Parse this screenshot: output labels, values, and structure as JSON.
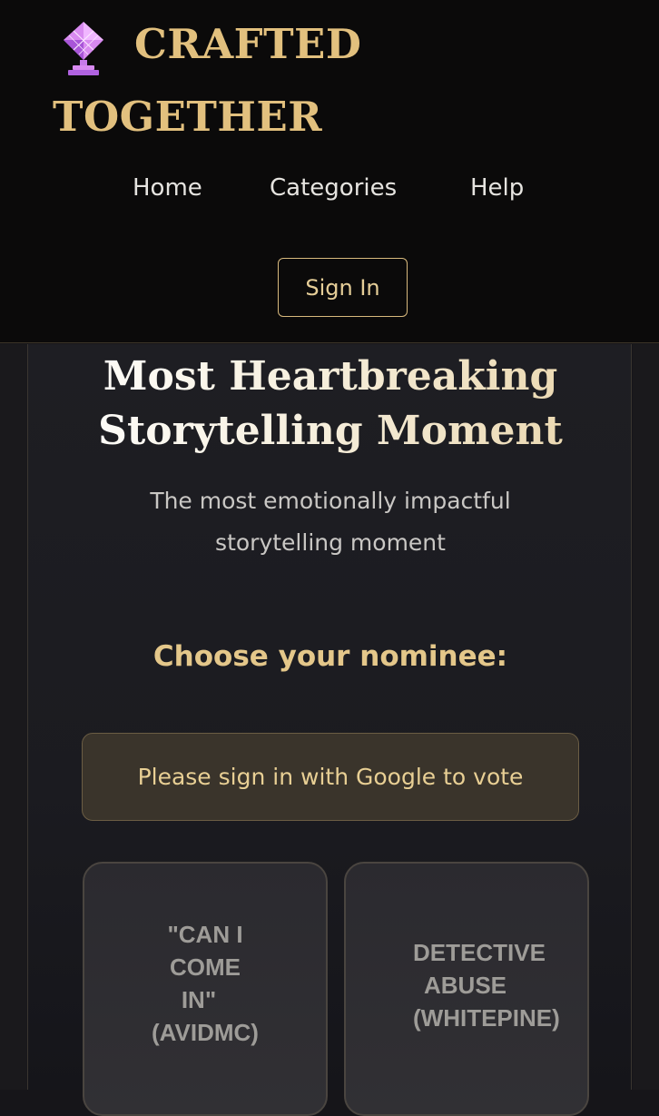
{
  "header": {
    "brand_line1": "CRAFTED",
    "brand_line2": "TOGETHER",
    "nav": [
      "Home",
      "Categories",
      "Help"
    ],
    "signin_label": "Sign In"
  },
  "category": {
    "title_line1": "Most Heartbreaking",
    "title_line2": "Storytelling Moment",
    "subtitle_line1": "The most emotionally impactful",
    "subtitle_line2": "storytelling moment",
    "choose_label": "Choose your nominee:",
    "signin_notice": "Please sign in with Google to vote"
  },
  "nominees": [
    {
      "lines": [
        "\"CAN I",
        "COME",
        "IN\"",
        "(AVIDMC)"
      ]
    },
    {
      "lines": [
        "DETECTIVE",
        "ABUSE",
        "(WHITEPINE)"
      ]
    }
  ],
  "colors": {
    "accent_gold": "#e2c07e",
    "header_bg": "#0b0a0a",
    "page_bg": "#161519"
  },
  "icons": {
    "logo": "trophy-crystal-icon"
  }
}
